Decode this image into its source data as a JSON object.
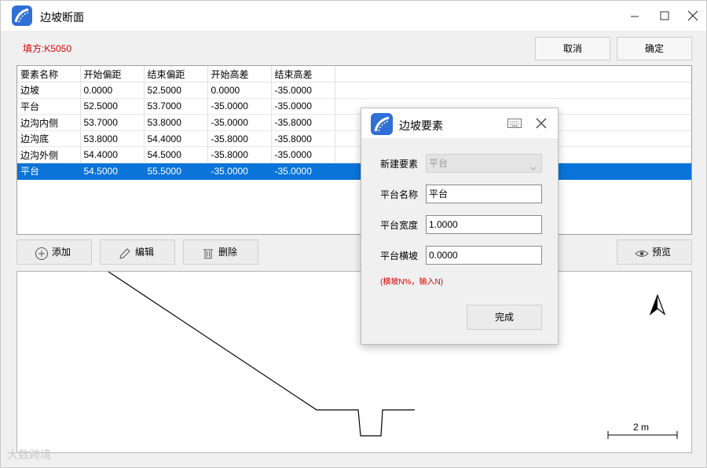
{
  "window": {
    "title": "边坡断面"
  },
  "header": {
    "fill_label": "填方:K5050",
    "cancel_label": "取消",
    "ok_label": "确定"
  },
  "table": {
    "columns": [
      "要素名称",
      "开始偏距",
      "结束偏距",
      "开始高差",
      "结束高差"
    ],
    "rows": [
      [
        "边坡",
        "0.0000",
        "52.5000",
        "0.0000",
        "-35.0000"
      ],
      [
        "平台",
        "52.5000",
        "53.7000",
        "-35.0000",
        "-35.0000"
      ],
      [
        "边沟内侧",
        "53.7000",
        "53.8000",
        "-35.0000",
        "-35.8000"
      ],
      [
        "边沟底",
        "53.8000",
        "54.4000",
        "-35.8000",
        "-35.8000"
      ],
      [
        "边沟外侧",
        "54.4000",
        "54.5000",
        "-35.8000",
        "-35.0000"
      ],
      [
        "平台",
        "54.5000",
        "55.5000",
        "-35.0000",
        "-35.0000"
      ]
    ],
    "selected_row": 5
  },
  "toolbar": {
    "add_label": "添加",
    "edit_label": "编辑",
    "delete_label": "删除",
    "preview_label": "预览"
  },
  "canvas": {
    "scale_label": "2 m"
  },
  "watermark": "大数跨境",
  "dialog": {
    "title": "边坡要素",
    "new_element_label": "新建要素",
    "new_element_value": "平台",
    "name_label": "平台名称",
    "name_value": "平台",
    "width_label": "平台宽度",
    "width_value": "1.0000",
    "slope_label": "平台横坡",
    "slope_value": "0.0000",
    "hint": "(横坡N%，输入N)",
    "done_label": "完成"
  },
  "colors": {
    "accent": "#0a74d8",
    "warning": "#dd0000",
    "icon_blue": "#2f6fd6"
  }
}
